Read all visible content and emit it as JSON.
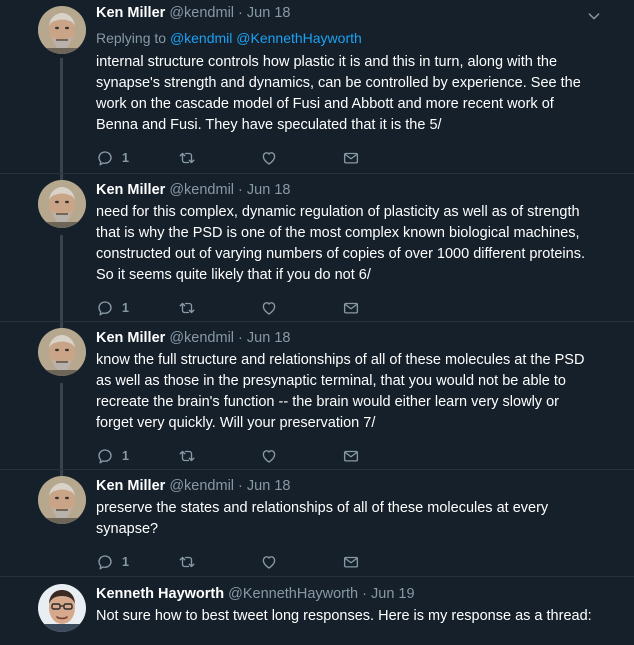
{
  "colors": {
    "background": "#15202b",
    "secondary_text": "#8899a6",
    "link": "#1da1f2",
    "divider": "#253341"
  },
  "tweets": [
    {
      "name": "Ken Miller",
      "handle": "@kendmil",
      "dot": "·",
      "date": "Jun 18",
      "replying_prefix": "Replying to ",
      "replying_mentions": "@kendmil @KennethHayworth",
      "text": "internal structure controls how plastic it is and this in turn, along with the synapse's strength and dynamics, can be controlled by experience. See the work on the cascade model of Fusi and Abbott and more recent work of Benna and Fusi. They have speculated that it is the 5/",
      "reply_count": "1"
    },
    {
      "name": "Ken Miller",
      "handle": "@kendmil",
      "dot": "·",
      "date": "Jun 18",
      "text": "need for this complex, dynamic regulation of plasticity as well as of strength that is why the PSD is one of the most complex known biological machines, constructed out of varying numbers of copies of over 1000 different proteins. So it seems quite likely that if you do not 6/",
      "reply_count": "1"
    },
    {
      "name": "Ken Miller",
      "handle": "@kendmil",
      "dot": "·",
      "date": "Jun 18",
      "text": "know the full structure and relationships of all of these molecules at the PSD as well as those in the presynaptic terminal, that you would not be able to recreate the brain's function -- the brain would either learn very slowly or forget very quickly. Will your preservation 7/",
      "reply_count": "1"
    },
    {
      "name": "Ken Miller",
      "handle": "@kendmil",
      "dot": "·",
      "date": "Jun 18",
      "text": "preserve the states and relationships of all of these molecules at every synapse?",
      "reply_count": "1"
    },
    {
      "name": "Kenneth Hayworth",
      "handle": "@KennethHayworth",
      "dot": "·",
      "date": "Jun 19",
      "text": "Not sure how to best tweet long responses. Here is my response as a thread:"
    }
  ],
  "icons": {
    "reply": "reply-icon",
    "retweet": "retweet-icon",
    "like": "heart-icon",
    "message": "envelope-icon",
    "more": "chevron-down-icon"
  }
}
